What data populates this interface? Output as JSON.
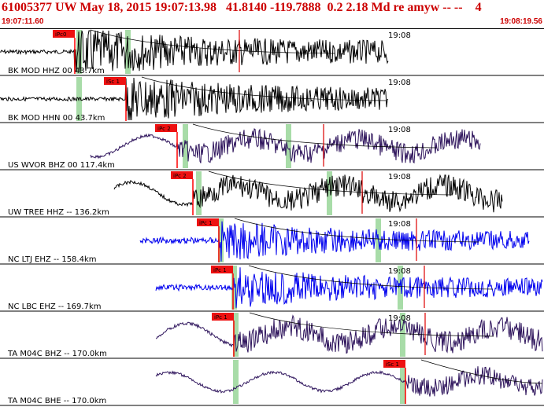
{
  "header": {
    "title": "61005377 UW May 18, 2015 19:07:13.98   41.8140 -119.7888  0.2 2.18 Md re amyw -- --    4",
    "time_start": "19:07:11.60",
    "time_end": "19:08:19.56"
  },
  "colors": {
    "header_text": "#cc0000",
    "pick_box": "#ee1111",
    "pick_line": "#ff0000",
    "window": "#a8dca8",
    "separator": "#000000"
  },
  "traces": [
    {
      "label": "BK MOD HHZ 00 43.7km",
      "pick": "iPc0",
      "minute_mark": "19:08",
      "color": "#000000",
      "pick_t": 0.138,
      "windows": [
        0.145,
        0.235
      ],
      "arrival": [
        0.44
      ]
    },
    {
      "label": "BK MOD HHN 00 43.7km",
      "pick": "iSc 1",
      "minute_mark": "19:08",
      "color": "#000000",
      "pick_t": 0.232,
      "windows": [
        0.145
      ],
      "arrival": []
    },
    {
      "label": "US WVOR BHZ 00 117.4km",
      "pick": "iPc 2",
      "minute_mark": "19:08",
      "color": "#2e145c",
      "pick_t": 0.325,
      "windows": [
        0.34,
        0.53
      ],
      "arrival": [
        0.595
      ]
    },
    {
      "label": "UW TREE HHZ -- 136.2km",
      "pick": "iPc 2",
      "minute_mark": "19:08",
      "color": "#000000",
      "pick_t": 0.355,
      "windows": [
        0.365,
        0.605
      ],
      "arrival": [
        0.665
      ]
    },
    {
      "label": "NC LTJ EHZ -- 158.4km",
      "pick": "iPc 1",
      "minute_mark": "19:08",
      "color": "#0000ee",
      "pick_t": 0.402,
      "windows": [
        0.405,
        0.695
      ],
      "arrival": [
        0.765
      ]
    },
    {
      "label": "NC LBC EHZ -- 169.7km",
      "pick": "iPc 1",
      "minute_mark": "19:08",
      "color": "#0000ee",
      "pick_t": 0.428,
      "windows": [
        0.43,
        0.735
      ],
      "arrival": [
        0.78
      ]
    },
    {
      "label": "TA M04C BHZ -- 170.0km",
      "pick": "iPc 1",
      "minute_mark": "19:08",
      "color": "#2e145c",
      "pick_t": 0.43,
      "windows": [
        0.432,
        0.74
      ],
      "arrival": [
        0.782
      ]
    },
    {
      "label": "TA M04C BHE -- 170.0km",
      "pick": "iSc 1",
      "minute_mark": "",
      "color": "#2e145c",
      "pick_t": 0.745,
      "windows": [
        0.432,
        0.74
      ],
      "arrival": []
    }
  ]
}
